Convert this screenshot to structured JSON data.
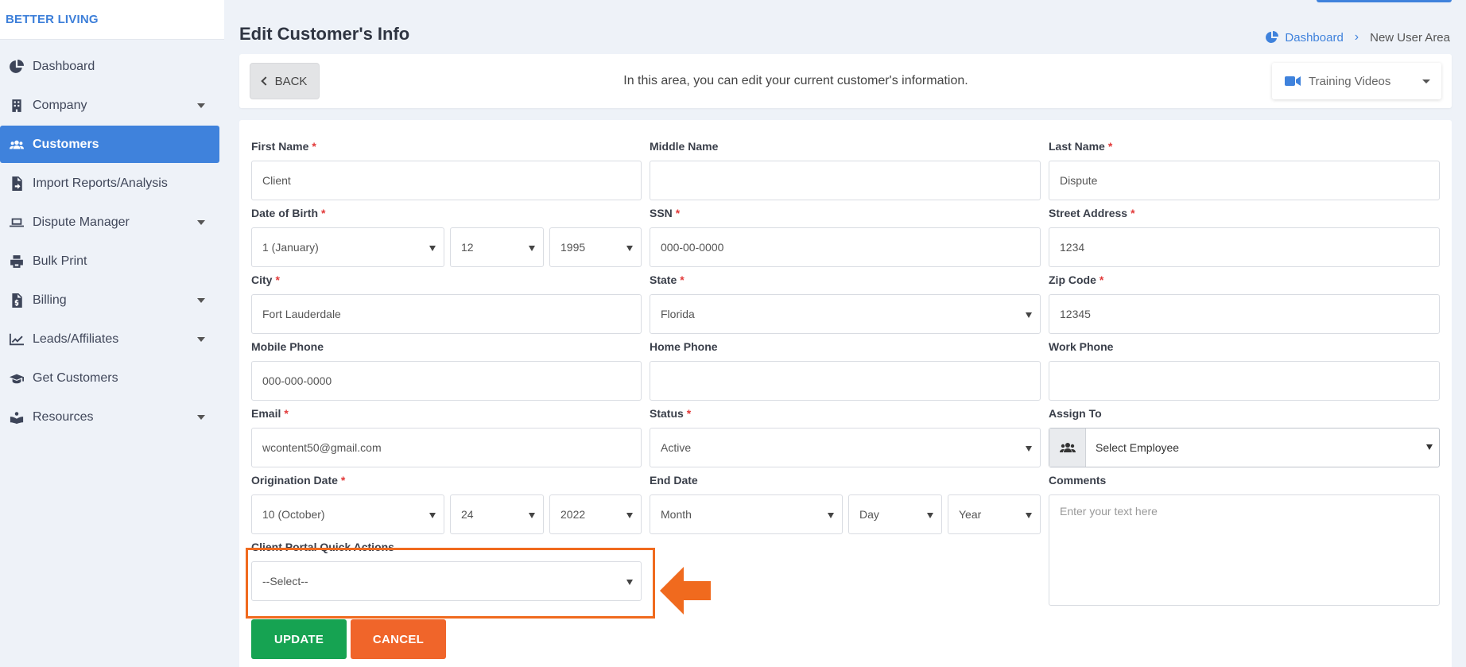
{
  "brand": "BETTER LIVING",
  "sidebar": {
    "items": [
      {
        "label": "Dashboard",
        "icon": "pie-chart-icon",
        "has_caret": false,
        "active": false
      },
      {
        "label": "Company",
        "icon": "building-icon",
        "has_caret": true,
        "active": false
      },
      {
        "label": "Customers",
        "icon": "users-icon",
        "has_caret": false,
        "active": true
      },
      {
        "label": "Import Reports/Analysis",
        "icon": "file-import-icon",
        "has_caret": false,
        "active": false
      },
      {
        "label": "Dispute Manager",
        "icon": "laptop-icon",
        "has_caret": true,
        "active": false
      },
      {
        "label": "Bulk Print",
        "icon": "printer-icon",
        "has_caret": false,
        "active": false
      },
      {
        "label": "Billing",
        "icon": "invoice-icon",
        "has_caret": true,
        "active": false
      },
      {
        "label": "Leads/Affiliates",
        "icon": "line-chart-icon",
        "has_caret": true,
        "active": false
      },
      {
        "label": "Get Customers",
        "icon": "graduation-cap-icon",
        "has_caret": false,
        "active": false
      },
      {
        "label": "Resources",
        "icon": "reader-icon",
        "has_caret": true,
        "active": false
      }
    ]
  },
  "header": {
    "title": "Edit Customer's Info",
    "breadcrumb": {
      "home": "Dashboard",
      "current": "New User Area"
    }
  },
  "info_bar": {
    "back_label": "BACK",
    "text": "In this area, you can edit your current customer's information.",
    "training_label": "Training Videos"
  },
  "form": {
    "first_name": {
      "label": "First Name",
      "value": "Client"
    },
    "middle_name": {
      "label": "Middle Name",
      "value": ""
    },
    "last_name": {
      "label": "Last Name",
      "value": "Dispute"
    },
    "dob": {
      "label": "Date of Birth",
      "month": "1 (January)",
      "day": "12",
      "year": "1995"
    },
    "ssn": {
      "label": "SSN",
      "value": "000-00-0000"
    },
    "street": {
      "label": "Street Address",
      "value": "1234"
    },
    "city": {
      "label": "City",
      "value": "Fort Lauderdale"
    },
    "state": {
      "label": "State",
      "value": "Florida"
    },
    "zip": {
      "label": "Zip Code",
      "value": "12345"
    },
    "mobile": {
      "label": "Mobile Phone",
      "value": "000-000-0000"
    },
    "home": {
      "label": "Home Phone",
      "value": ""
    },
    "work": {
      "label": "Work Phone",
      "value": ""
    },
    "email": {
      "label": "Email",
      "value": "wcontent50@gmail.com"
    },
    "status": {
      "label": "Status",
      "value": "Active"
    },
    "assign": {
      "label": "Assign To",
      "value": "Select Employee"
    },
    "origination": {
      "label": "Origination Date",
      "month": "10 (October)",
      "day": "24",
      "year": "2022"
    },
    "end_date": {
      "label": "End Date",
      "month": "Month",
      "day": "Day",
      "year": "Year"
    },
    "comments": {
      "label": "Comments",
      "placeholder": "Enter your text here"
    },
    "quick_actions": {
      "label": "Client Portal Quick Actions",
      "value": "--Select--"
    }
  },
  "buttons": {
    "update": "UPDATE",
    "cancel": "CANCEL"
  },
  "colors": {
    "accent": "#3f82dc",
    "required": "#e23a3a",
    "update": "#16a352",
    "cancel": "#f0652a",
    "highlight": "#f06a1e"
  }
}
